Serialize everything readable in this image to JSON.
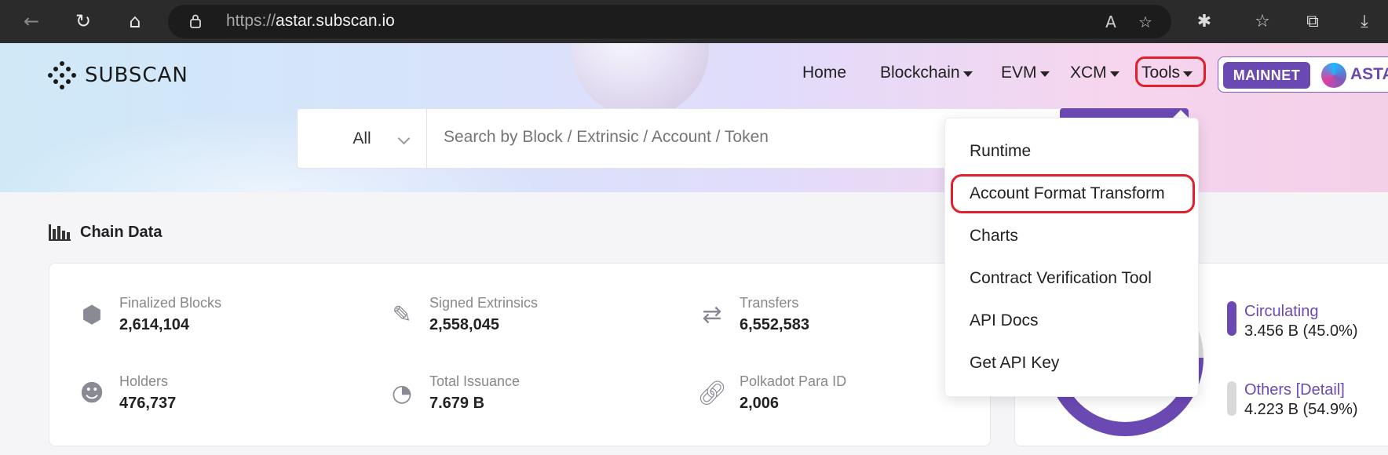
{
  "browser": {
    "url_protocol": "https://",
    "url_host": "astar.subscan.io"
  },
  "header": {
    "logo_text": "SUBSCAN",
    "nav": [
      {
        "label": "Home"
      },
      {
        "label": "Blockchain"
      },
      {
        "label": "EVM"
      },
      {
        "label": "XCM"
      },
      {
        "label": "Tools"
      }
    ],
    "network_badge": "MAINNET",
    "network_name": "ASTAR"
  },
  "search": {
    "category": "All",
    "placeholder": "Search by Block / Extrinsic / Account / Token"
  },
  "tools_menu": {
    "items": [
      {
        "label": "Runtime"
      },
      {
        "label": "Account Format Transform"
      },
      {
        "label": "Charts"
      },
      {
        "label": "Contract Verification Tool"
      },
      {
        "label": "API Docs"
      },
      {
        "label": "Get API Key"
      }
    ]
  },
  "chain_data": {
    "title": "Chain Data",
    "stats": [
      {
        "label": "Finalized Blocks",
        "value": "2,614,104",
        "icon": "cube-icon"
      },
      {
        "label": "Signed Extrinsics",
        "value": "2,558,045",
        "icon": "document-edit-icon"
      },
      {
        "label": "Transfers",
        "value": "6,552,583",
        "icon": "transfer-icon"
      },
      {
        "label": "Holders",
        "value": "476,737",
        "icon": "user-icon"
      },
      {
        "label": "Total Issuance",
        "value": "7.679 B",
        "icon": "pie-icon"
      },
      {
        "label": "Polkadot Para ID",
        "value": "2,006",
        "icon": "link-icon"
      }
    ]
  },
  "supply": {
    "circulating_label": "Circulating",
    "circulating_value": "3.456 B  (45.0%)",
    "others_label": "Others",
    "detail_link": "[Detail]",
    "others_value": "4.223 B  (54.9%)",
    "colors": {
      "circulating": "#6b49b3",
      "others": "#d9d9d9"
    }
  }
}
